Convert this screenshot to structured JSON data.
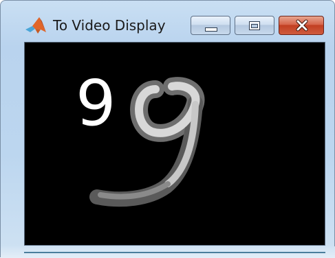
{
  "window": {
    "title": "To Video Display",
    "app_icon": "matlab-logo-icon",
    "controls": {
      "minimize_icon": "minimize-icon",
      "maximize_icon": "maximize-icon",
      "close_icon": "close-icon"
    }
  },
  "display": {
    "background_color": "#000000",
    "large_digit_text": "9",
    "small_digit_text": "9"
  },
  "colors": {
    "close_button": "#c84428",
    "title_bar": "#bcd6ef",
    "digit": "#ffffff"
  }
}
